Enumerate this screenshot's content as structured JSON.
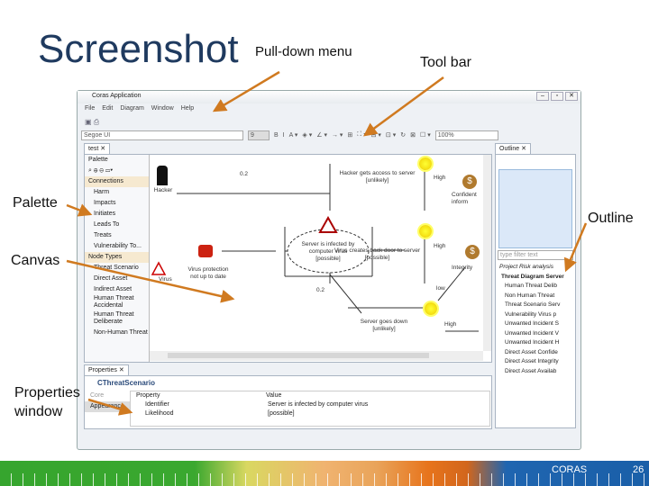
{
  "slide": {
    "title": "Screenshot",
    "annotations": {
      "pulldown": "Pull-down menu",
      "toolbar": "Tool bar",
      "palette": "Palette",
      "outline": "Outline",
      "canvas": "Canvas",
      "properties_1": "Properties",
      "properties_2": "window"
    },
    "footer": {
      "brand": "CORAS",
      "page": "26"
    },
    "accent": "#d07a20"
  },
  "window": {
    "title": "Coras Application",
    "controls": [
      "–",
      "▫",
      "✕"
    ]
  },
  "menu": [
    "File",
    "Edit",
    "Diagram",
    "Window",
    "Help"
  ],
  "toolbar": {
    "font": "Segoe UI",
    "size": "9",
    "zoom": "100%",
    "buttons": [
      "B",
      "I",
      "A ▾",
      "◈ ▾",
      "∠ ▾",
      "→ ▾",
      "⊞",
      "⛶ ▾",
      "⊟ ▾",
      "⊡ ▾",
      "↻",
      "⊠",
      "☐ ▾"
    ]
  },
  "editor": {
    "tab": "test ✕",
    "palette_title": "Palette",
    "connections_header": "Connections",
    "connections": [
      "Harm",
      "Impacts",
      "Initiates",
      "Leads To",
      "Treats",
      "Vulnerability To..."
    ],
    "nodes_header": "Node Types",
    "nodes": [
      "Threat Scenario",
      "Direct Asset",
      "Indirect Asset",
      "Human Threat Accidental",
      "Human Threat Deliberate",
      "Non-Human Threat"
    ]
  },
  "diagram": {
    "hacker": "Hacker",
    "prob1": "0.2",
    "prob2": "0.2",
    "s1_line1": "Hacker gets access to server",
    "s1_line2": "[unlikely]",
    "s2_line1": "Virus creates back door to server",
    "s2_line2": "[possible]",
    "s3_line1": "Server goes down",
    "s3_line2": "[unlikely]",
    "scenario_line1": "Server is infected by",
    "scenario_line2": "computer virus",
    "scenario_line3": "[possible]",
    "vuln_line1": "Virus protection",
    "vuln_line2": "not up to date",
    "virus": "Virus",
    "high1": "High",
    "high2": "High",
    "high3": "High",
    "low": "low",
    "asset1_line1": "Confident",
    "asset1_line2": "inform",
    "asset2": "Integrity"
  },
  "outline": {
    "tab": "Outline ✕",
    "filter_placeholder": "type filter text",
    "root": "Project Risk analysis",
    "diagram": "Threat Diagram Server",
    "items": [
      "Human Threat Delib",
      "Non Human Threat",
      "Threat Scenario Serv",
      "Vulnerability Virus p",
      "Unwanted Incident S",
      "Unwanted Incident V",
      "Unwanted Incident H",
      "Direct Asset Confide",
      "Direct Asset Integrity",
      "Direct Asset Availab"
    ]
  },
  "properties": {
    "tab": "Properties ✕",
    "heading": "CThreatScenario",
    "side_tabs": [
      "Core",
      "Appearance"
    ],
    "col_property": "Property",
    "col_value": "Value",
    "rows": [
      {
        "property": "Identifier",
        "value": "Server is infected by computer virus"
      },
      {
        "property": "Likelihood",
        "value": "[possible]"
      }
    ]
  }
}
